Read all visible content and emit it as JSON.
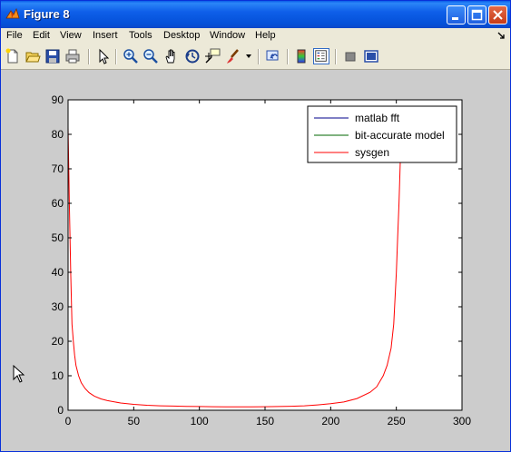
{
  "window": {
    "title": "Figure 8"
  },
  "menu": [
    "File",
    "Edit",
    "View",
    "Insert",
    "Tools",
    "Desktop",
    "Window",
    "Help"
  ],
  "chart_data": {
    "type": "line",
    "title": "",
    "xlabel": "",
    "ylabel": "",
    "xlim": [
      0,
      300
    ],
    "ylim": [
      0,
      90
    ],
    "xticks": [
      0,
      50,
      100,
      150,
      200,
      250,
      300
    ],
    "yticks": [
      0,
      10,
      20,
      30,
      40,
      50,
      60,
      70,
      80,
      90
    ],
    "grid": false,
    "legend_position": "top-right",
    "series": [
      {
        "name": "matlab fft",
        "color": "#00008b",
        "x": [],
        "y": []
      },
      {
        "name": "bit-accurate model",
        "color": "#006400",
        "x": [],
        "y": []
      },
      {
        "name": "sysgen",
        "color": "#ff0000",
        "x": [
          0,
          1,
          2,
          3,
          4,
          5,
          6,
          8,
          10,
          13,
          16,
          20,
          25,
          30,
          40,
          50,
          60,
          70,
          80,
          90,
          100,
          110,
          120,
          128,
          140,
          150,
          160,
          170,
          180,
          190,
          200,
          210,
          220,
          230,
          235,
          240,
          243,
          246,
          248,
          250,
          251,
          252,
          253,
          254,
          255
        ],
        "y": [
          82,
          60,
          40,
          25,
          20,
          16,
          13,
          10,
          8,
          6.3,
          5.1,
          4.1,
          3.3,
          2.8,
          2.1,
          1.7,
          1.45,
          1.3,
          1.2,
          1.12,
          1.07,
          1.03,
          1.01,
          1.0,
          1.01,
          1.03,
          1.07,
          1.15,
          1.3,
          1.55,
          1.9,
          2.4,
          3.4,
          5.2,
          6.8,
          10,
          13,
          18,
          25,
          40,
          50,
          60,
          72,
          80,
          82
        ]
      }
    ]
  }
}
